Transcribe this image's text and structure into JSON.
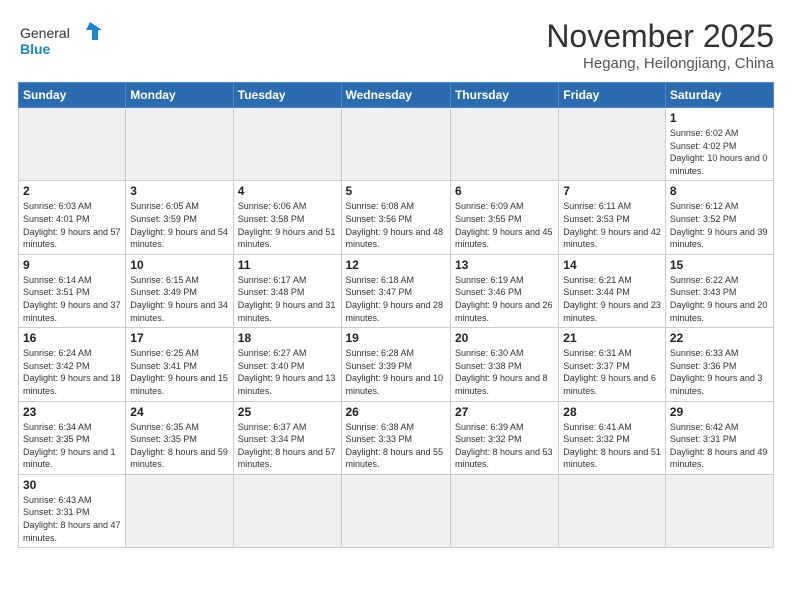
{
  "header": {
    "logo_general": "General",
    "logo_blue": "Blue",
    "month_title": "November 2025",
    "location": "Hegang, Heilongjiang, China"
  },
  "weekdays": [
    "Sunday",
    "Monday",
    "Tuesday",
    "Wednesday",
    "Thursday",
    "Friday",
    "Saturday"
  ],
  "weeks": [
    [
      {
        "day": "",
        "info": ""
      },
      {
        "day": "",
        "info": ""
      },
      {
        "day": "",
        "info": ""
      },
      {
        "day": "",
        "info": ""
      },
      {
        "day": "",
        "info": ""
      },
      {
        "day": "",
        "info": ""
      },
      {
        "day": "1",
        "info": "Sunrise: 6:02 AM\nSunset: 4:02 PM\nDaylight: 10 hours and 0 minutes."
      }
    ],
    [
      {
        "day": "2",
        "info": "Sunrise: 6:03 AM\nSunset: 4:01 PM\nDaylight: 9 hours and 57 minutes."
      },
      {
        "day": "3",
        "info": "Sunrise: 6:05 AM\nSunset: 3:59 PM\nDaylight: 9 hours and 54 minutes."
      },
      {
        "day": "4",
        "info": "Sunrise: 6:06 AM\nSunset: 3:58 PM\nDaylight: 9 hours and 51 minutes."
      },
      {
        "day": "5",
        "info": "Sunrise: 6:08 AM\nSunset: 3:56 PM\nDaylight: 9 hours and 48 minutes."
      },
      {
        "day": "6",
        "info": "Sunrise: 6:09 AM\nSunset: 3:55 PM\nDaylight: 9 hours and 45 minutes."
      },
      {
        "day": "7",
        "info": "Sunrise: 6:11 AM\nSunset: 3:53 PM\nDaylight: 9 hours and 42 minutes."
      },
      {
        "day": "8",
        "info": "Sunrise: 6:12 AM\nSunset: 3:52 PM\nDaylight: 9 hours and 39 minutes."
      }
    ],
    [
      {
        "day": "9",
        "info": "Sunrise: 6:14 AM\nSunset: 3:51 PM\nDaylight: 9 hours and 37 minutes."
      },
      {
        "day": "10",
        "info": "Sunrise: 6:15 AM\nSunset: 3:49 PM\nDaylight: 9 hours and 34 minutes."
      },
      {
        "day": "11",
        "info": "Sunrise: 6:17 AM\nSunset: 3:48 PM\nDaylight: 9 hours and 31 minutes."
      },
      {
        "day": "12",
        "info": "Sunrise: 6:18 AM\nSunset: 3:47 PM\nDaylight: 9 hours and 28 minutes."
      },
      {
        "day": "13",
        "info": "Sunrise: 6:19 AM\nSunset: 3:46 PM\nDaylight: 9 hours and 26 minutes."
      },
      {
        "day": "14",
        "info": "Sunrise: 6:21 AM\nSunset: 3:44 PM\nDaylight: 9 hours and 23 minutes."
      },
      {
        "day": "15",
        "info": "Sunrise: 6:22 AM\nSunset: 3:43 PM\nDaylight: 9 hours and 20 minutes."
      }
    ],
    [
      {
        "day": "16",
        "info": "Sunrise: 6:24 AM\nSunset: 3:42 PM\nDaylight: 9 hours and 18 minutes."
      },
      {
        "day": "17",
        "info": "Sunrise: 6:25 AM\nSunset: 3:41 PM\nDaylight: 9 hours and 15 minutes."
      },
      {
        "day": "18",
        "info": "Sunrise: 6:27 AM\nSunset: 3:40 PM\nDaylight: 9 hours and 13 minutes."
      },
      {
        "day": "19",
        "info": "Sunrise: 6:28 AM\nSunset: 3:39 PM\nDaylight: 9 hours and 10 minutes."
      },
      {
        "day": "20",
        "info": "Sunrise: 6:30 AM\nSunset: 3:38 PM\nDaylight: 9 hours and 8 minutes."
      },
      {
        "day": "21",
        "info": "Sunrise: 6:31 AM\nSunset: 3:37 PM\nDaylight: 9 hours and 6 minutes."
      },
      {
        "day": "22",
        "info": "Sunrise: 6:33 AM\nSunset: 3:36 PM\nDaylight: 9 hours and 3 minutes."
      }
    ],
    [
      {
        "day": "23",
        "info": "Sunrise: 6:34 AM\nSunset: 3:35 PM\nDaylight: 9 hours and 1 minute."
      },
      {
        "day": "24",
        "info": "Sunrise: 6:35 AM\nSunset: 3:35 PM\nDaylight: 8 hours and 59 minutes."
      },
      {
        "day": "25",
        "info": "Sunrise: 6:37 AM\nSunset: 3:34 PM\nDaylight: 8 hours and 57 minutes."
      },
      {
        "day": "26",
        "info": "Sunrise: 6:38 AM\nSunset: 3:33 PM\nDaylight: 8 hours and 55 minutes."
      },
      {
        "day": "27",
        "info": "Sunrise: 6:39 AM\nSunset: 3:32 PM\nDaylight: 8 hours and 53 minutes."
      },
      {
        "day": "28",
        "info": "Sunrise: 6:41 AM\nSunset: 3:32 PM\nDaylight: 8 hours and 51 minutes."
      },
      {
        "day": "29",
        "info": "Sunrise: 6:42 AM\nSunset: 3:31 PM\nDaylight: 8 hours and 49 minutes."
      }
    ],
    [
      {
        "day": "30",
        "info": "Sunrise: 6:43 AM\nSunset: 3:31 PM\nDaylight: 8 hours and 47 minutes."
      },
      {
        "day": "",
        "info": ""
      },
      {
        "day": "",
        "info": ""
      },
      {
        "day": "",
        "info": ""
      },
      {
        "day": "",
        "info": ""
      },
      {
        "day": "",
        "info": ""
      },
      {
        "day": "",
        "info": ""
      }
    ]
  ]
}
